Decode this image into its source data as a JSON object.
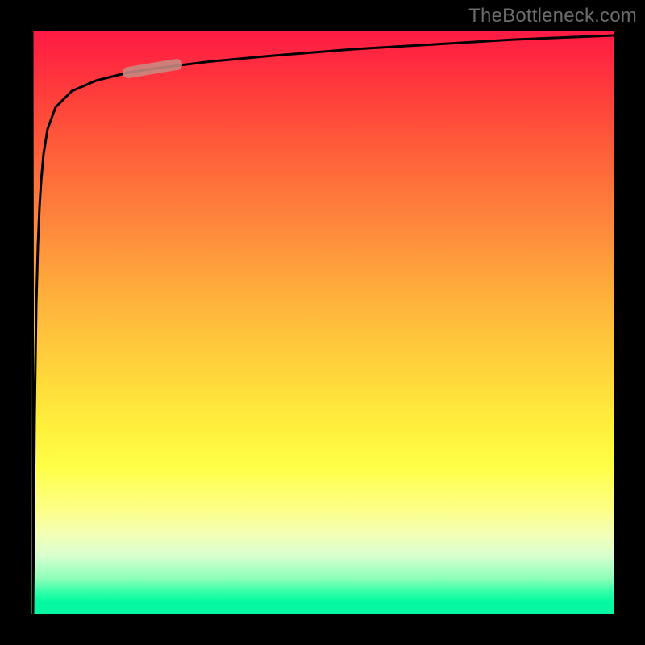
{
  "watermark": "TheBottleneck.com",
  "colors": {
    "frame": "#000000",
    "gradient_top": "#ff1a44",
    "gradient_mid": "#ffd43b",
    "gradient_bottom": "#06f9a2",
    "curve": "#000000",
    "highlight": "#c88a83"
  },
  "chart_data": {
    "type": "line",
    "title": "",
    "xlabel": "",
    "ylabel": "",
    "xlim": [
      0,
      100
    ],
    "ylim": [
      0,
      100
    ],
    "grid": false,
    "legend": false,
    "series": [
      {
        "name": "curve",
        "x": [
          0.14,
          0.28,
          0.55,
          0.83,
          1.11,
          1.39,
          1.66,
          2.08,
          2.77,
          4.16,
          6.93,
          11.08,
          16.62,
          22.16,
          30.47,
          41.55,
          55.4,
          69.25,
          83.1,
          100.0
        ],
        "y": [
          100.0,
          0.0,
          33.8,
          53.0,
          63.2,
          69.8,
          74.3,
          78.9,
          83.2,
          87.0,
          89.8,
          91.6,
          92.9,
          93.8,
          94.8,
          95.8,
          97.0,
          97.8,
          98.6,
          99.3
        ]
      }
    ],
    "highlight_segment": {
      "x_range": [
        16.6,
        25.0
      ],
      "y_range": [
        92.9,
        94.3
      ]
    }
  }
}
